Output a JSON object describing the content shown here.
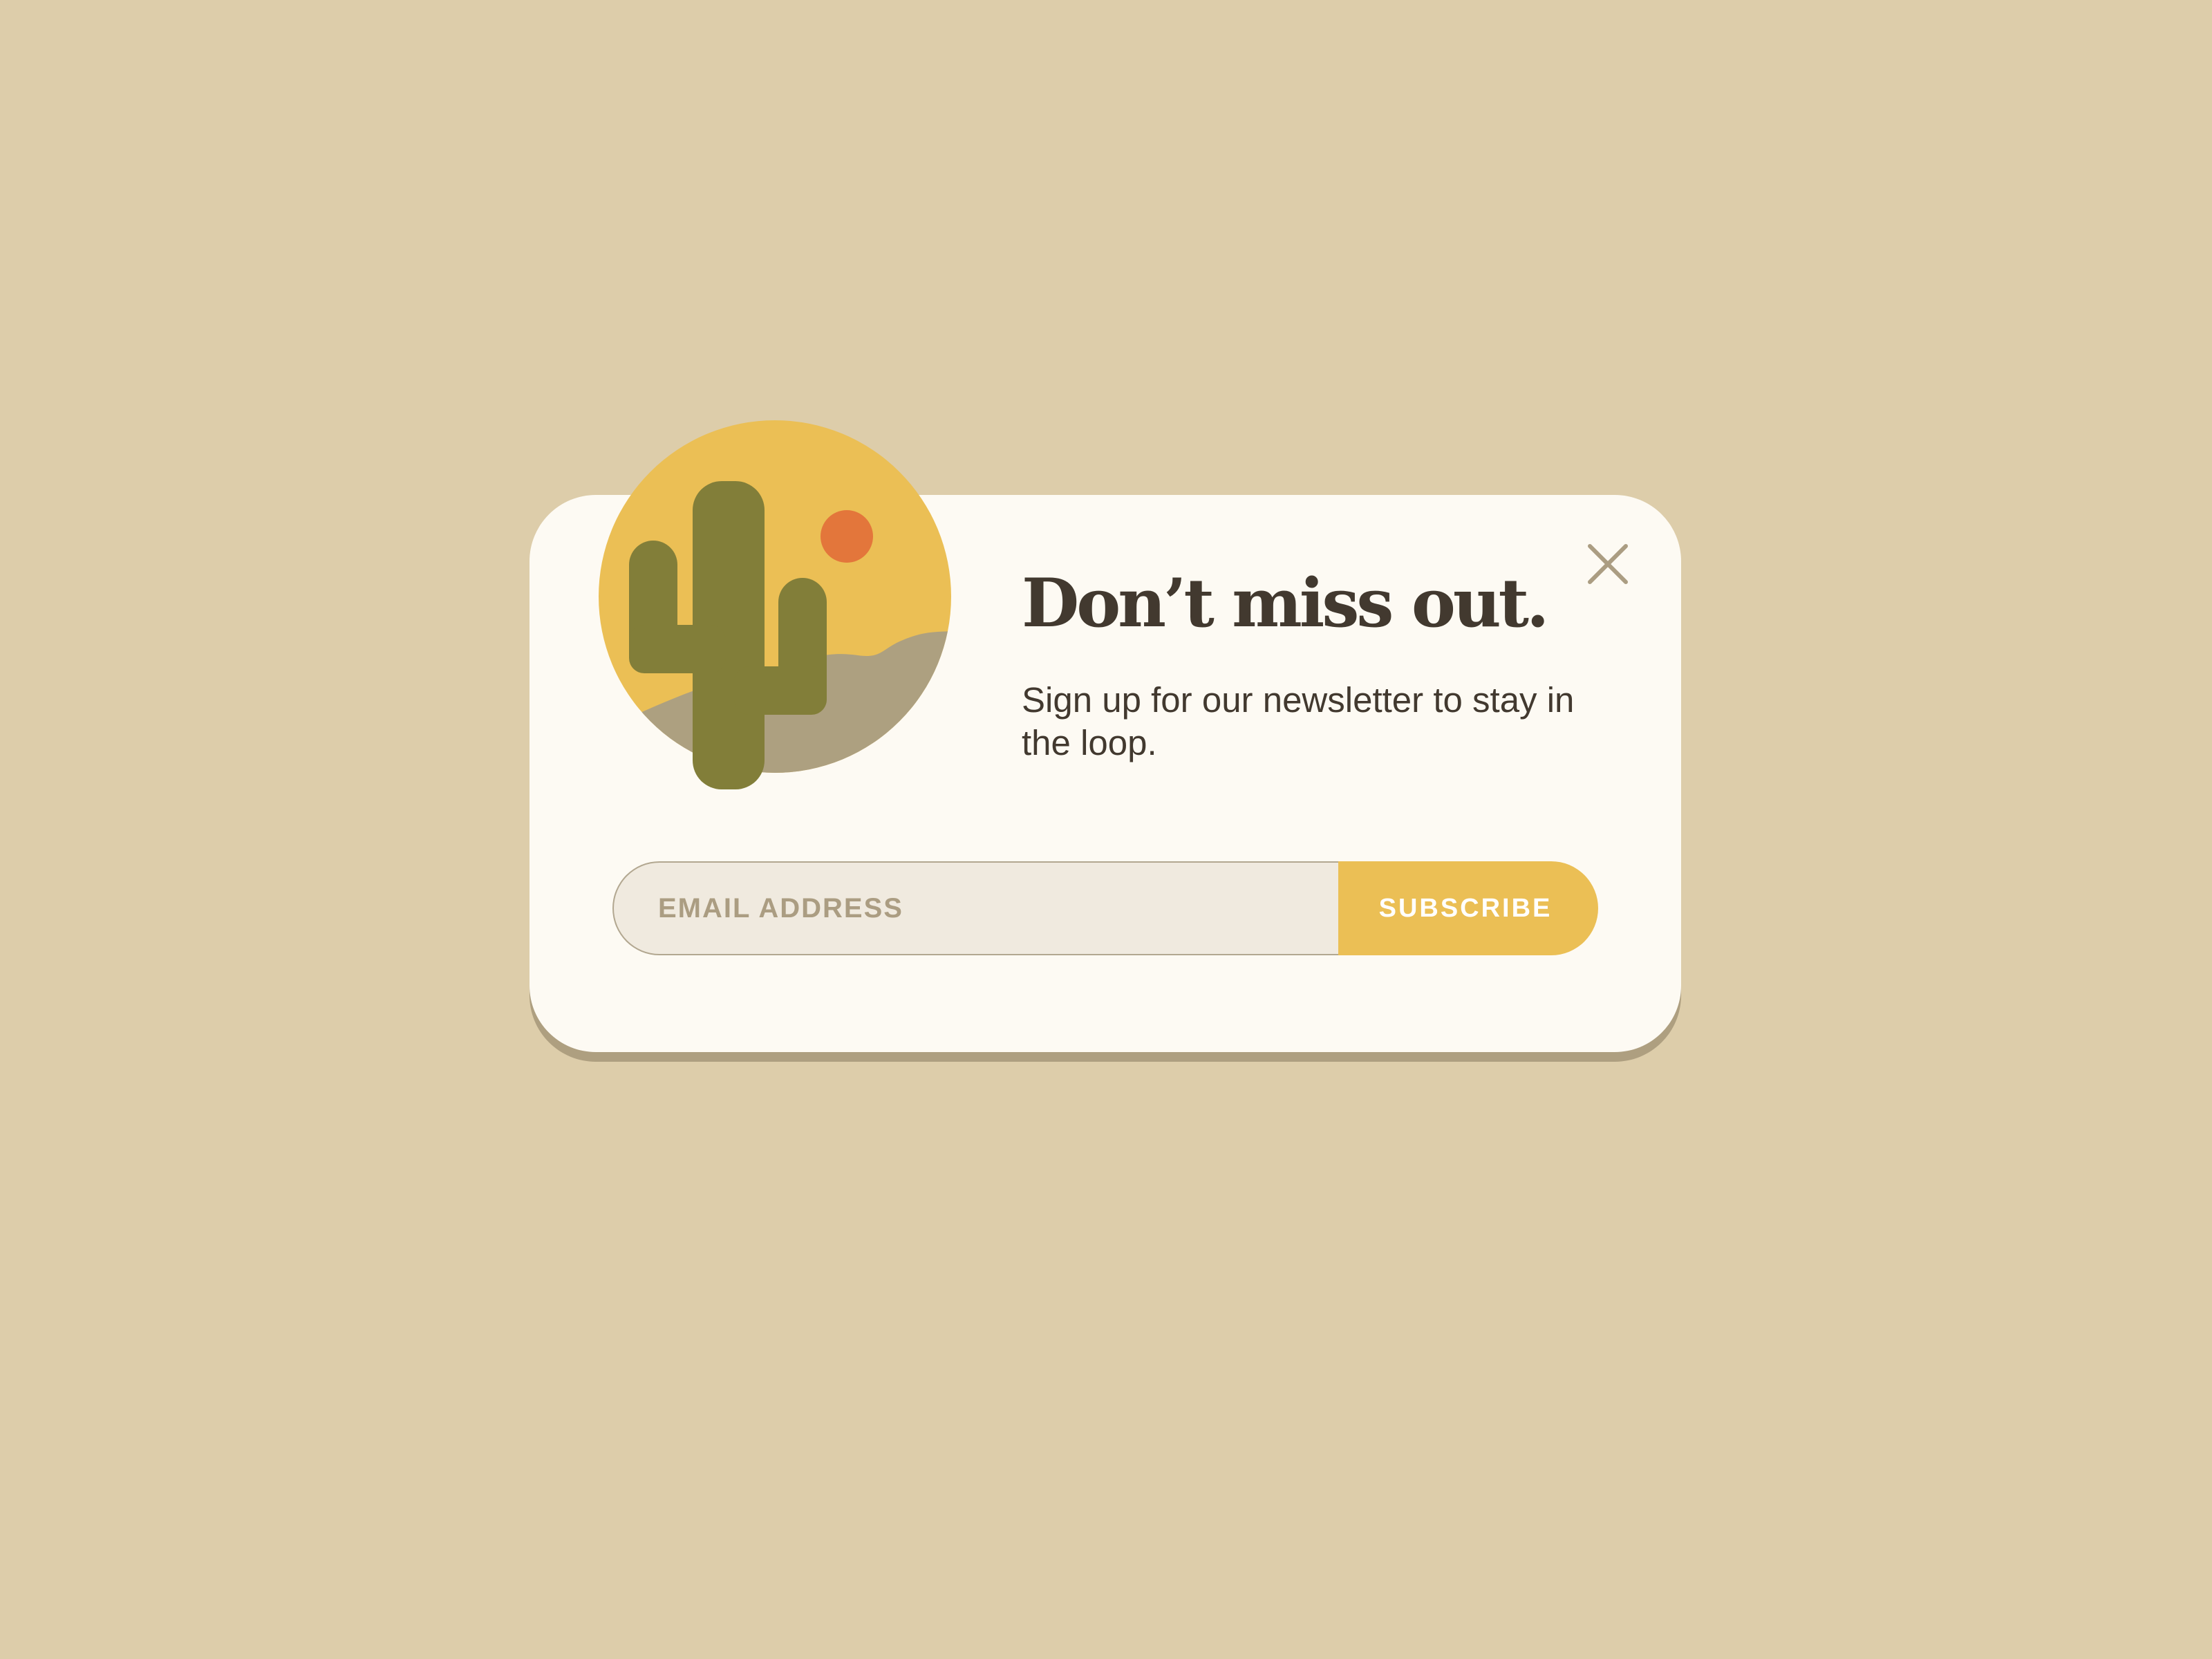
{
  "popup": {
    "title": "Don’t miss out.",
    "subtitle": "Sign up for our newsletter to stay in the loop.",
    "email_placeholder": "EMAIL ADDRESS",
    "subscribe_label": "SUBSCRIBE"
  },
  "icons": {
    "illustration": "cactus-desert-illustration",
    "close": "close-icon"
  },
  "colors": {
    "background": "#ddcdaa",
    "card": "#fdfaf3",
    "card_shadow": "#ae9f80",
    "text": "#42392f",
    "accent_yellow": "#ebbf55",
    "sun": "#e3763b",
    "cactus": "#827e39",
    "hills": "#ada080",
    "input_bg": "#f0eadf",
    "placeholder": "#ab9d82"
  }
}
